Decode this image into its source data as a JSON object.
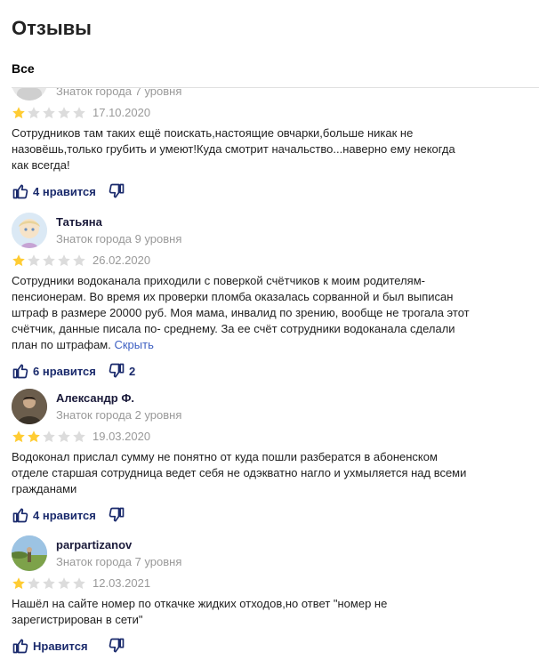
{
  "page": {
    "title": "Отзывы"
  },
  "tabs": {
    "all": "Все"
  },
  "reviews": [
    {
      "author": "",
      "level": "Знаток города 7 уровня",
      "rating": 1,
      "date": "17.10.2020",
      "text": "Сотрудников там таких ещё поискать,настоящие овчарки,больше никак не назовёшь,только грубить и умеют!Куда смотрит начальство...наверно ему некогда как всегда!",
      "hide_label": "",
      "likes": "4 нравится",
      "dislikes": ""
    },
    {
      "author": "Татьяна",
      "level": "Знаток города 9 уровня",
      "rating": 1,
      "date": "26.02.2020",
      "text": "Сотрудники водоканала приходили с поверкой счётчиков к моим родителям-пенсионерам. Во время их проверки пломба оказалась сорванной и был выписан штраф в размере 20000 руб. Моя мама, инвалид по зрению, вообще не трогала этот счётчик, данные писала по- среднему. За ее счёт сотрудники водоканала сделали план по штрафам.",
      "hide_label": "Скрыть",
      "likes": "6 нравится",
      "dislikes": "2"
    },
    {
      "author": "Александр Ф.",
      "level": "Знаток города 2 уровня",
      "rating": 2,
      "date": "19.03.2020",
      "text": "Водоконал прислал сумму не понятно от куда пошли разбератся в абоненском отделе старшая сотрудница ведет себя не одэкватно нагло и ухмыляется над всеми гражданами",
      "hide_label": "",
      "likes": "4 нравится",
      "dislikes": ""
    },
    {
      "author": "parpartizanov",
      "level": "Знаток города 7 уровня",
      "rating": 1,
      "date": "12.03.2021",
      "text": "Нашёл на сайте номер по откачке жидких отходов,но ответ \"номер не зарегистрирован в сети\"",
      "hide_label": "",
      "likes": "Нравится",
      "dislikes": ""
    }
  ],
  "colors": {
    "star_filled": "#fc3",
    "star_empty": "#dcdcdc",
    "accent": "#1a2a6c",
    "link": "#3d5fc2"
  },
  "icons": {
    "like": "thumb-up-icon",
    "dislike": "thumb-down-icon"
  }
}
